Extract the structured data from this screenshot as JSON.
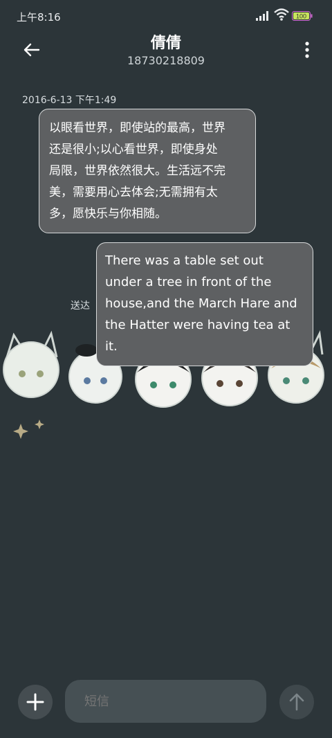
{
  "status_bar": {
    "time": "上午8:16",
    "battery": "100"
  },
  "header": {
    "contact_name": "倩倩",
    "phone_number": "18730218809"
  },
  "conversation": {
    "timestamp": "2016-6-13 下午1:49",
    "messages": [
      {
        "direction": "incoming",
        "lines": [
          "以眼看世界，即使站的最高，世界",
          "还是很小;以心看世界，即使身处",
          "局限，世界依然很大。生活远不完",
          "美，需要用心去体会;无需拥有太",
          "多，愿快乐与你相随。"
        ]
      },
      {
        "direction": "outgoing",
        "status": "送达",
        "lines": [
          "There was a table set out",
          "under a tree in front of the",
          "house,and the March Hare and",
          "the Hatter were having tea at",
          "it."
        ]
      }
    ]
  },
  "composer": {
    "placeholder": "短信"
  },
  "colors": {
    "background": "#2c3539",
    "bubble": "#5e6062",
    "bubble_border": "#d8dadb",
    "input_bg": "#465054"
  },
  "icons": [
    "back-arrow-icon",
    "more-vertical-icon",
    "plus-icon",
    "send-arrow-icon",
    "signal-icon",
    "wifi-icon",
    "battery-icon"
  ]
}
